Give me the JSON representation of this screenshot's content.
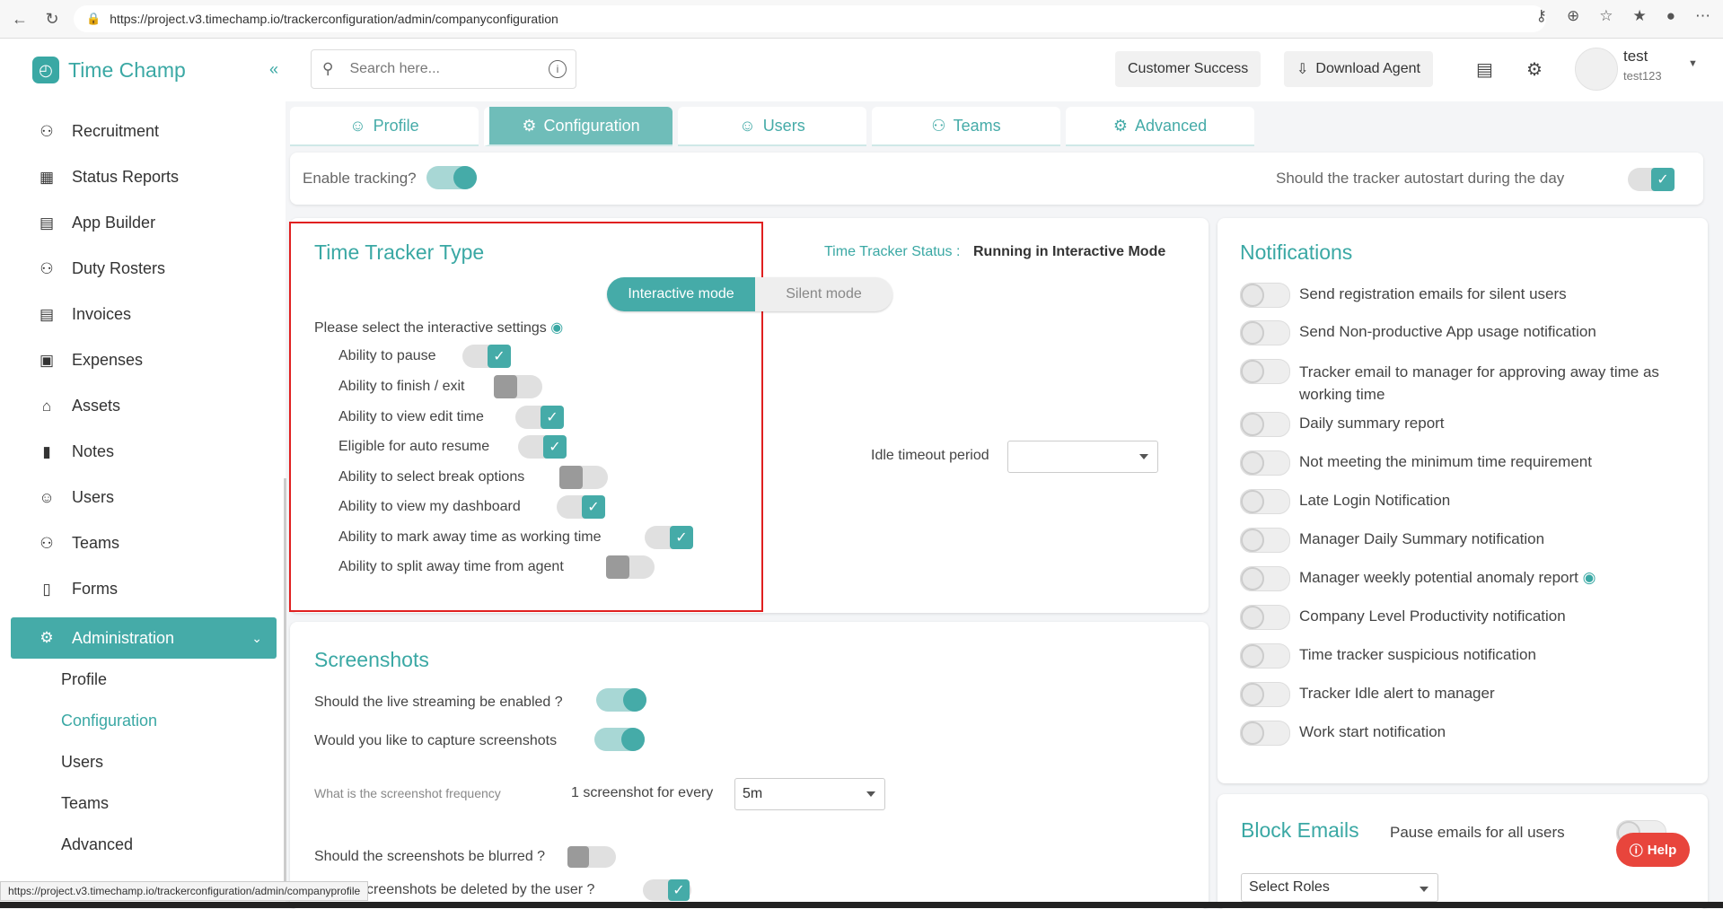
{
  "browser": {
    "url": "https://project.v3.timechamp.io/trackerconfiguration/admin/companyconfiguration"
  },
  "app": {
    "name": "Time Champ"
  },
  "sidebar": {
    "items": [
      {
        "label": "Recruitment",
        "icon": "people-icon"
      },
      {
        "label": "Status Reports",
        "icon": "dashboard-icon"
      },
      {
        "label": "App Builder",
        "icon": "list-icon"
      },
      {
        "label": "Duty Rosters",
        "icon": "user-add-icon"
      },
      {
        "label": "Invoices",
        "icon": "invoice-icon"
      },
      {
        "label": "Expenses",
        "icon": "wallet-icon"
      },
      {
        "label": "Assets",
        "icon": "bank-icon"
      },
      {
        "label": "Notes",
        "icon": "note-icon"
      },
      {
        "label": "Users",
        "icon": "user-icon"
      },
      {
        "label": "Teams",
        "icon": "team-icon"
      },
      {
        "label": "Forms",
        "icon": "form-icon"
      }
    ],
    "admin_label": "Administration",
    "sub_items": [
      "Profile",
      "Configuration",
      "Users",
      "Teams",
      "Advanced"
    ]
  },
  "header": {
    "search_placeholder": "Search here...",
    "customer_success": "Customer Success",
    "download_agent": "Download Agent",
    "user_name": "test",
    "user_sub": "test123"
  },
  "tabs": [
    "Profile",
    "Configuration",
    "Users",
    "Teams",
    "Advanced"
  ],
  "tracking": {
    "enable_label": "Enable tracking?",
    "autostart_label": "Should the tracker autostart during the day"
  },
  "tracker_type": {
    "title": "Time Tracker Type",
    "status_label": "Time Tracker Status :",
    "status_value": "Running in Interactive Mode",
    "mode_interactive": "Interactive mode",
    "mode_silent": "Silent mode",
    "settings_label": "Please select the interactive settings",
    "settings": [
      {
        "label": "Ability to pause",
        "on": true
      },
      {
        "label": "Ability to finish / exit",
        "on": false
      },
      {
        "label": "Ability to view edit time",
        "on": true
      },
      {
        "label": "Eligible for auto resume",
        "on": true
      },
      {
        "label": "Ability to select break options",
        "on": false
      },
      {
        "label": "Ability to view my dashboard",
        "on": true
      },
      {
        "label": "Ability to mark away time as working time",
        "on": true
      },
      {
        "label": "Ability to split away time from agent",
        "on": false
      }
    ],
    "idle_label": "Idle timeout period"
  },
  "screenshots": {
    "title": "Screenshots",
    "live_streaming": "Should the live streaming be enabled ?",
    "capture": "Would you like to capture screenshots",
    "frequency_label": "What is the screenshot frequency",
    "every_label": "1 screenshot for every",
    "frequency_value": "5m",
    "blurred": "Should the screenshots be blurred ?",
    "deleted": "screenshots be deleted by the user ?"
  },
  "notifications": {
    "title": "Notifications",
    "items": [
      "Send registration emails for silent users",
      "Send Non-productive App usage notification",
      "Tracker email to manager for approving away time as working time",
      "Daily summary report",
      "Not meeting the minimum time requirement",
      "Late Login Notification",
      "Manager Daily Summary notification",
      "Manager weekly potential anomaly report",
      "Company Level Productivity notification",
      "Time tracker suspicious notification",
      "Tracker Idle alert to manager",
      "Work start notification"
    ]
  },
  "block_emails": {
    "title": "Block Emails",
    "pause_label": "Pause emails for all users",
    "roles_placeholder": "Select Roles"
  },
  "help": "Help",
  "status_url": "https://project.v3.timechamp.io/trackerconfiguration/admin/companyprofile"
}
